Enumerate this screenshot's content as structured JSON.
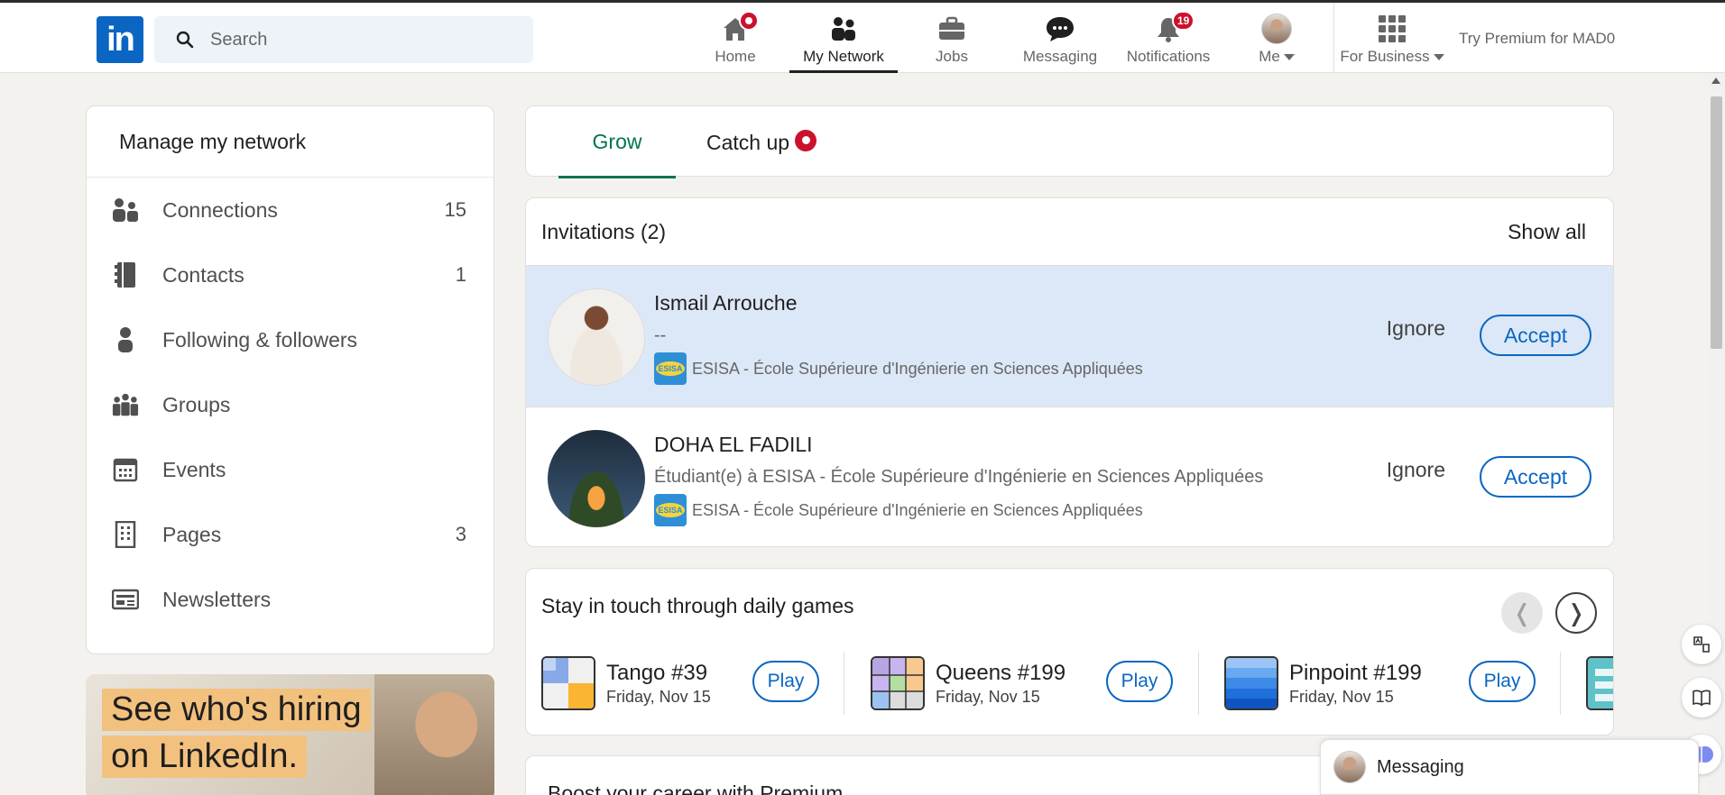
{
  "header": {
    "logo_text": "in",
    "search_placeholder": "Search",
    "nav": [
      {
        "label": "Home",
        "icon": "home-icon",
        "badge": "dot"
      },
      {
        "label": "My Network",
        "icon": "my-network-icon",
        "active": true
      },
      {
        "label": "Jobs",
        "icon": "briefcase-icon"
      },
      {
        "label": "Messaging",
        "icon": "messaging-icon"
      },
      {
        "label": "Notifications",
        "icon": "bell-icon",
        "badge": "19"
      },
      {
        "label": "Me",
        "icon": "avatar"
      }
    ],
    "for_business": "For Business",
    "premium": "Try Premium for MAD0"
  },
  "sidebar": {
    "title": "Manage my network",
    "items": [
      {
        "label": "Connections",
        "count": "15",
        "icon": "people-icon"
      },
      {
        "label": "Contacts",
        "count": "1",
        "icon": "contacts-book-icon"
      },
      {
        "label": "Following & followers",
        "count": "",
        "icon": "person-icon"
      },
      {
        "label": "Groups",
        "count": "",
        "icon": "groups-icon"
      },
      {
        "label": "Events",
        "count": "",
        "icon": "calendar-icon"
      },
      {
        "label": "Pages",
        "count": "3",
        "icon": "building-icon"
      },
      {
        "label": "Newsletters",
        "count": "",
        "icon": "newsletter-icon"
      }
    ],
    "ad": {
      "line1": "See who's hiring",
      "line2": "on LinkedIn."
    }
  },
  "tabs": {
    "grow": "Grow",
    "catch_up": "Catch up"
  },
  "invitations": {
    "title": "Invitations (2)",
    "show_all": "Show all",
    "items": [
      {
        "name": "Ismail Arrouche",
        "headline": "--",
        "school": "ESISA - École Supérieure d'Ingénierie en Sciences Appliquées",
        "school_logo": "ESISA",
        "ignore": "Ignore",
        "accept": "Accept"
      },
      {
        "name": "DOHA EL FADILI",
        "headline": "Étudiant(e) à ESISA - École Supérieure d'Ingénierie en Sciences Appliquées",
        "school": "ESISA - École Supérieure d'Ingénierie en Sciences Appliquées",
        "school_logo": "ESISA",
        "ignore": "Ignore",
        "accept": "Accept"
      }
    ]
  },
  "games": {
    "title": "Stay in touch through daily games",
    "items": [
      {
        "name": "Tango",
        "number": "#39",
        "date": "Friday, Nov 15",
        "play": "Play"
      },
      {
        "name": "Queens",
        "number": "#199",
        "date": "Friday, Nov 15",
        "play": "Play"
      },
      {
        "name": "Pinpoint",
        "number": "#199",
        "date": "Friday, Nov 15",
        "play": "Play"
      }
    ]
  },
  "premium_card": {
    "title": "Boost your career with Premium"
  },
  "messaging": {
    "label": "Messaging"
  },
  "colors": {
    "brand": "#0a66c2",
    "grow_green": "#01754f",
    "badge_red": "#cb112d",
    "highlight": "#dce8f7"
  }
}
